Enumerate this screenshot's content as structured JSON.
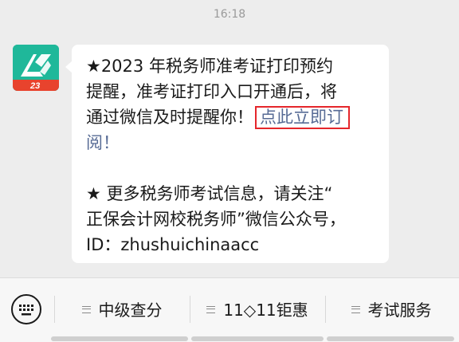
{
  "status": {
    "time": "16:18"
  },
  "sender": {
    "avatar_badge": "23",
    "avatar_icon": "logo-icon"
  },
  "message": {
    "p1_line1": "★2023 年税务师准考证打印预约",
    "p1_line2": "提醒，准考证打印入口开通后，将",
    "p1_line3_text": "通过微信及时提醒你！",
    "p1_line3_link": "点此立即订",
    "p1_line4_link": "阅！",
    "p2_line1": "★ 更多税务师考试信息，请关注“",
    "p2_line2": "正保会计网校税务师”微信公众号，",
    "p2_line3": "ID：zhushuichinaacc",
    "link_color": "#576b95",
    "highlight_color": "#e5262b"
  },
  "menu": {
    "keyboard_icon": "keyboard-icon",
    "items": [
      {
        "label": "中级查分"
      },
      {
        "label": "11◇11钜惠"
      },
      {
        "label": "考试服务"
      }
    ]
  }
}
